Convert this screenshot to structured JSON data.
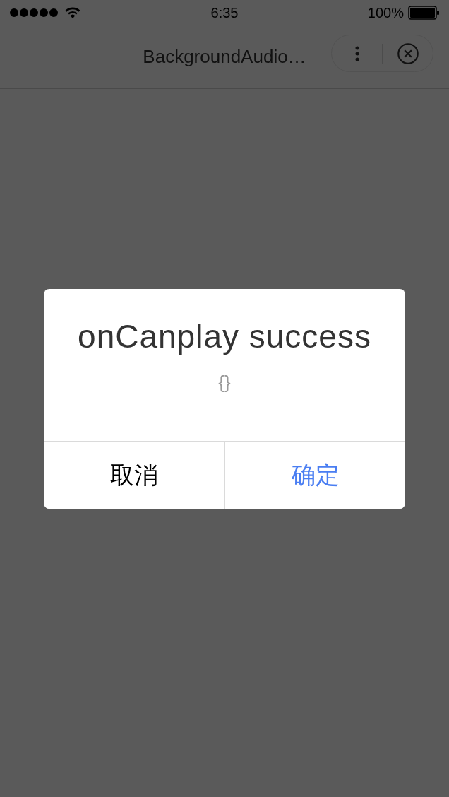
{
  "status_bar": {
    "time": "6:35",
    "battery": "100%"
  },
  "nav_bar": {
    "title": "BackgroundAudio…"
  },
  "dialog": {
    "title": "onCanplay success",
    "content": "{}",
    "buttons": [
      {
        "label": "取消",
        "kind": "cancel"
      },
      {
        "label": "确定",
        "kind": "confirm"
      }
    ]
  }
}
